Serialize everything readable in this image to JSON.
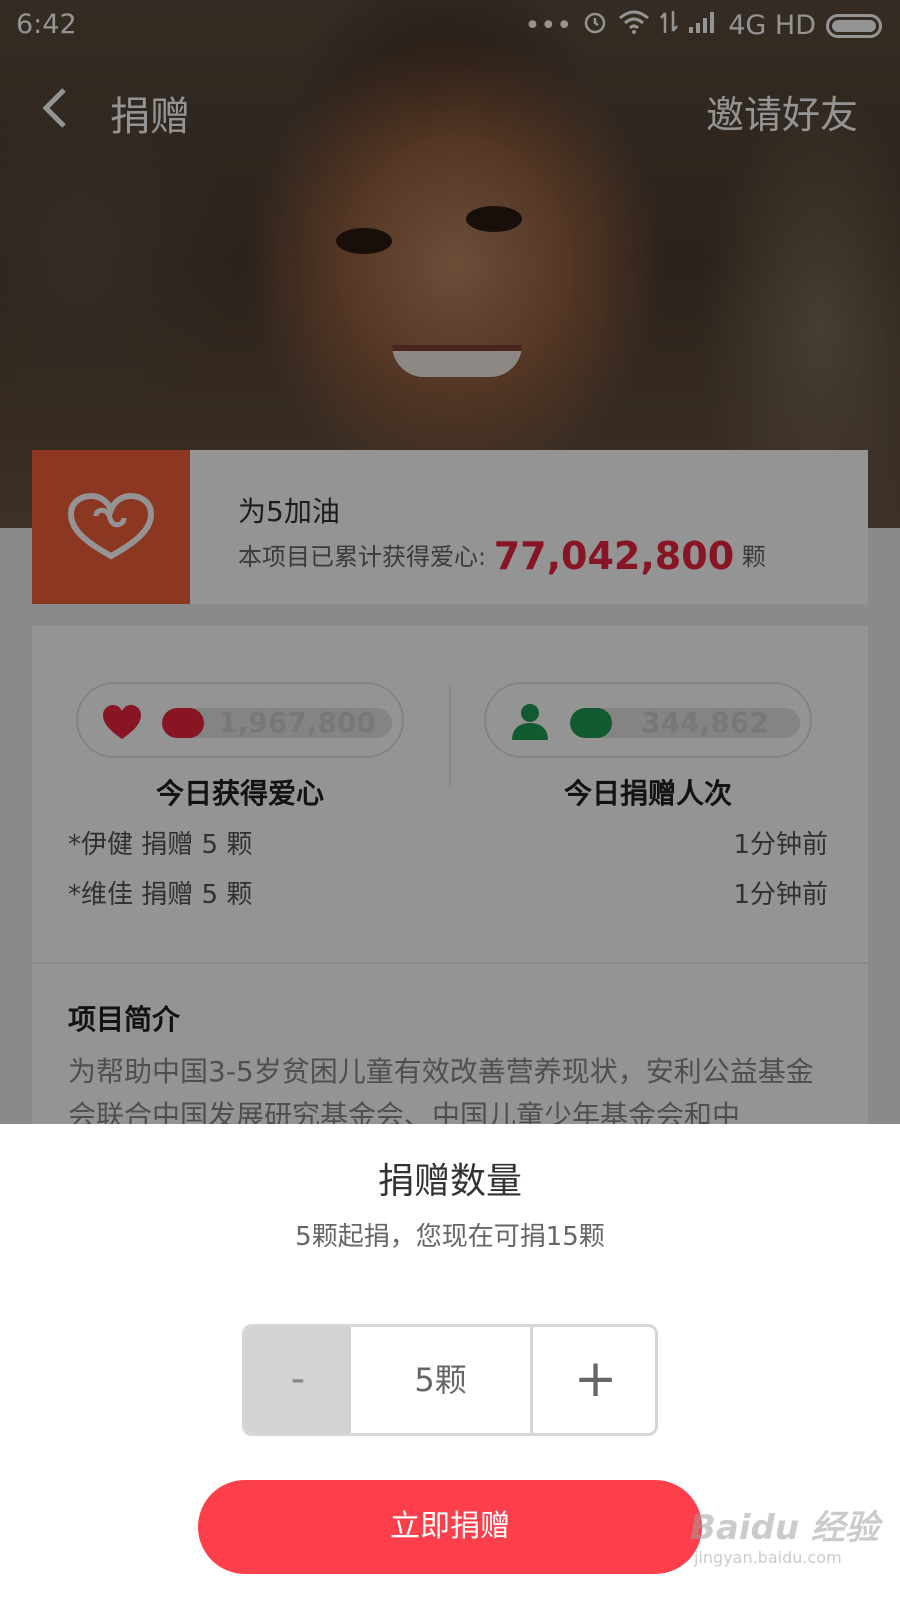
{
  "status_bar": {
    "time": "6:42",
    "signal_text": "4G HD"
  },
  "nav": {
    "title": "捐赠",
    "invite_label": "邀请好友"
  },
  "project": {
    "name": "为5加油",
    "total_prefix": "本项目已累计获得爱心:",
    "total_value": "77,042,800",
    "total_unit": "颗"
  },
  "stats": {
    "hearts_today": {
      "value": "1,967,800",
      "label": "今日获得爱心",
      "color": "#e8253f"
    },
    "donors_today": {
      "value": "344,862",
      "label": "今日捐赠人次",
      "color": "#1f9e55"
    }
  },
  "recent_donations": [
    {
      "who": "*伊健 捐赠 5 颗",
      "when": "1分钟前"
    },
    {
      "who": "*维佳 捐赠 5 颗",
      "when": "1分钟前"
    }
  ],
  "intro": {
    "title": "项目简介",
    "text": "为帮助中国3-5岁贫困儿童有效改善营养现状，安利公益基金会联合中国发展研究基金会、中国儿童少年基金会和中"
  },
  "donate_sheet": {
    "title": "捐赠数量",
    "subtitle": "5颗起捐，您现在可捐15颗",
    "minus_label": "-",
    "quantity": "5颗",
    "plus_label": "+",
    "button_label": "立即捐赠"
  },
  "watermark": {
    "line1": "Baidu 经验",
    "line2": "jingyan.baidu.com"
  },
  "colors": {
    "accent_red": "#fc3f4a",
    "logo_orange": "#f25f3a",
    "total_red": "#e8253f"
  }
}
